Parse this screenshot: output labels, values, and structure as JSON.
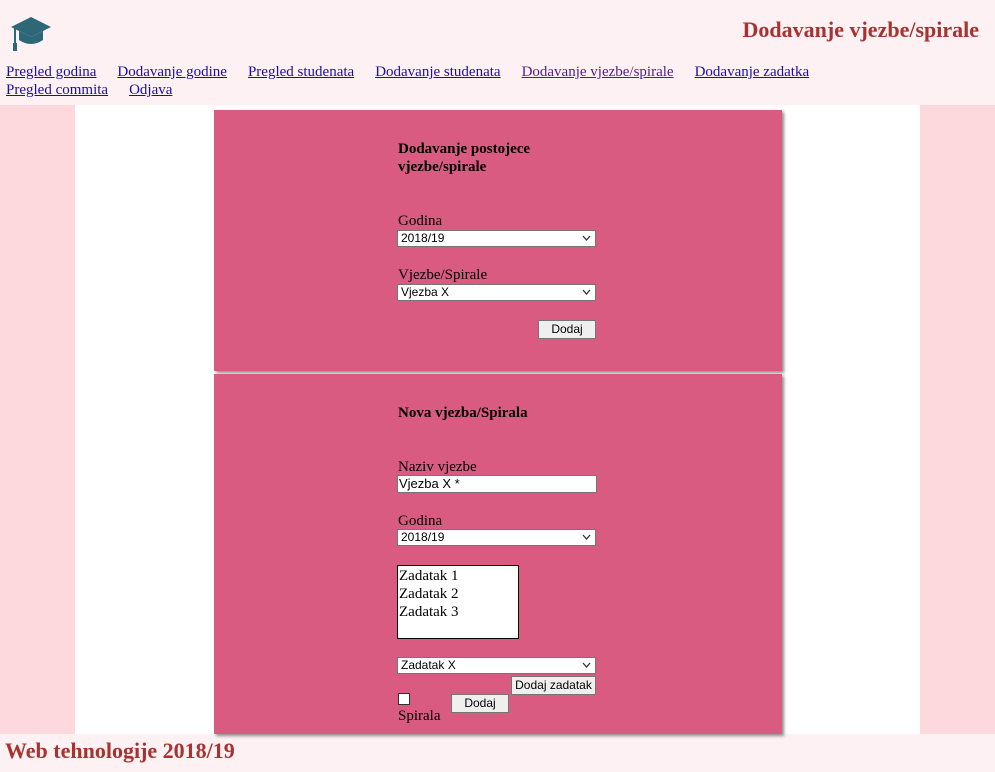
{
  "header": {
    "title": "Dodavanje vjezbe/spirale",
    "logo_icon": "graduation-cap-icon"
  },
  "nav": {
    "items": [
      {
        "label": "Pregled godina"
      },
      {
        "label": "Dodavanje godine"
      },
      {
        "label": "Pregled studenata"
      },
      {
        "label": "Dodavanje studenata"
      },
      {
        "label": "Dodavanje vjezbe/spirale"
      },
      {
        "label": "Dodavanje zadatka"
      },
      {
        "label": "Pregled commita"
      },
      {
        "label": "Odjava"
      }
    ]
  },
  "panel_existing": {
    "heading": "Dodavanje postojece vjezbe/spirale",
    "godina_label": "Godina",
    "godina_value": "2018/19",
    "vjezbe_label": "Vjezbe/Spirale",
    "vjezbe_value": "Vjezba X",
    "submit_label": "Dodaj"
  },
  "panel_new": {
    "heading": "Nova vjezba/Spirala",
    "naziv_label": "Naziv vjezbe",
    "naziv_value": "Vjezba X *",
    "godina_label": "Godina",
    "godina_value": "2018/19",
    "zadaci": [
      "Zadatak 1",
      "Zadatak 2",
      "Zadatak 3"
    ],
    "zadatak_select_value": "Zadatak X",
    "add_zadatak_label": "Dodaj zadatak",
    "spirala_label": "Spirala",
    "submit_label": "Dodaj"
  },
  "footer": {
    "text": "Web tehnologije 2018/19"
  },
  "colors": {
    "accent": "#a8322f",
    "panel": "#d95b82",
    "side": "#fdd9dd",
    "background": "#fdf1f3"
  }
}
